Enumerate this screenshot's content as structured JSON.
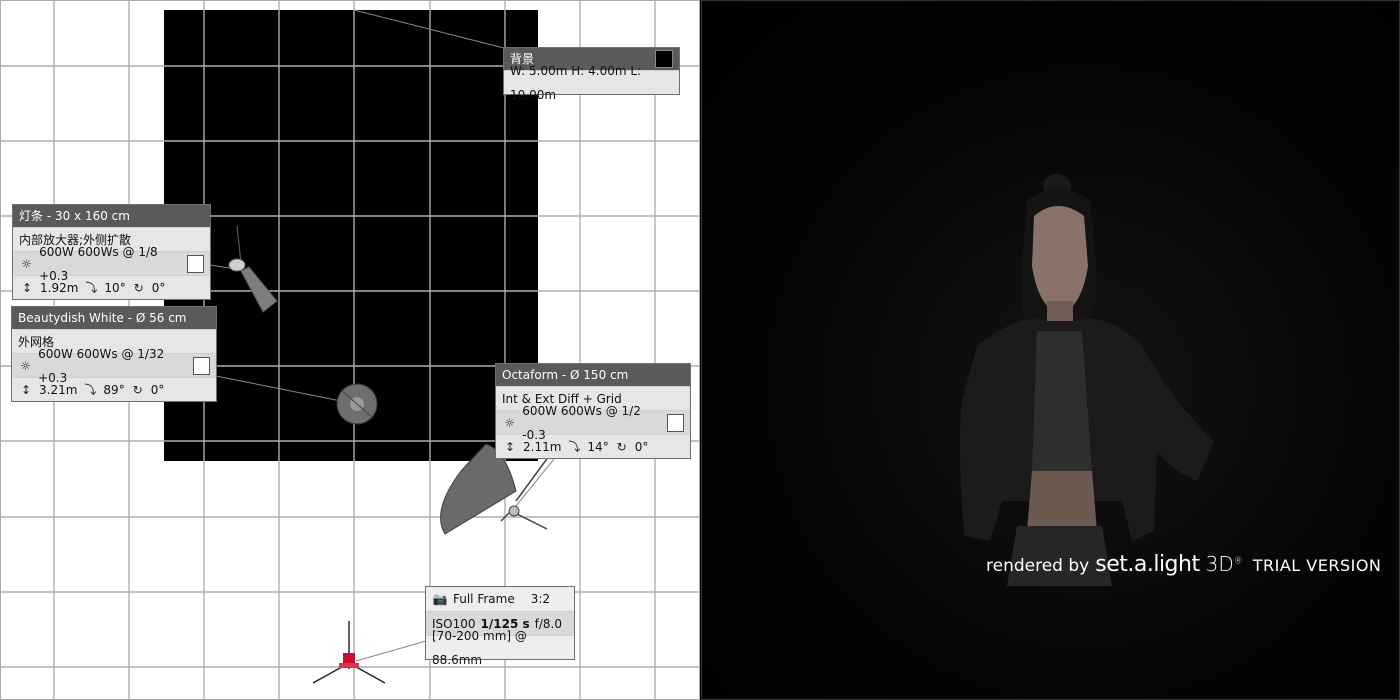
{
  "background_card": {
    "title": "背景",
    "dims": "W: 5.00m H: 4.00m L: 10.00m",
    "swatch_color": "#000000"
  },
  "strip_light": {
    "title": "灯条 - 30 x 160 cm",
    "modifier": "内部放大器;外侧扩散",
    "power": "600W 600Ws @ 1/8 +0.3",
    "height": "1.92m",
    "tilt": "10°",
    "rotation": "0°"
  },
  "beautydish": {
    "title": "Beautydish White - Ø 56 cm",
    "modifier": "外网格",
    "power": "600W 600Ws @ 1/32 +0.3",
    "height": "3.21m",
    "tilt": "89°",
    "rotation": "0°"
  },
  "octaform": {
    "title": "Octaform - Ø 150 cm",
    "modifier": "Int & Ext Diff + Grid",
    "power": "600W 600Ws @ 1/2 -0.3",
    "height": "2.11m",
    "tilt": "14°",
    "rotation": "0°"
  },
  "camera": {
    "sensor": "Full Frame",
    "ratio": "3:2",
    "iso": "ISO100",
    "shutter": "1/125 s",
    "aperture": "f/8.0",
    "lens": "[70-200 mm] @ 88.6mm"
  },
  "render": {
    "watermark_prefix": "rendered by",
    "watermark_brand": "set.a.light",
    "watermark_3d": "3D",
    "watermark_reg": "®",
    "watermark_trial": "TRIAL VERSION"
  },
  "icons": {
    "power": "sun-icon",
    "height": "height-arrows-icon",
    "tilt": "tilt-icon",
    "rotation": "rotation-icon",
    "camera": "camera-icon"
  },
  "colors": {
    "card_header": "#5a5a5a",
    "card_body": "#e6e6e6",
    "grid_line": "#a9b0b8",
    "tripod_red": "#c8102e"
  }
}
